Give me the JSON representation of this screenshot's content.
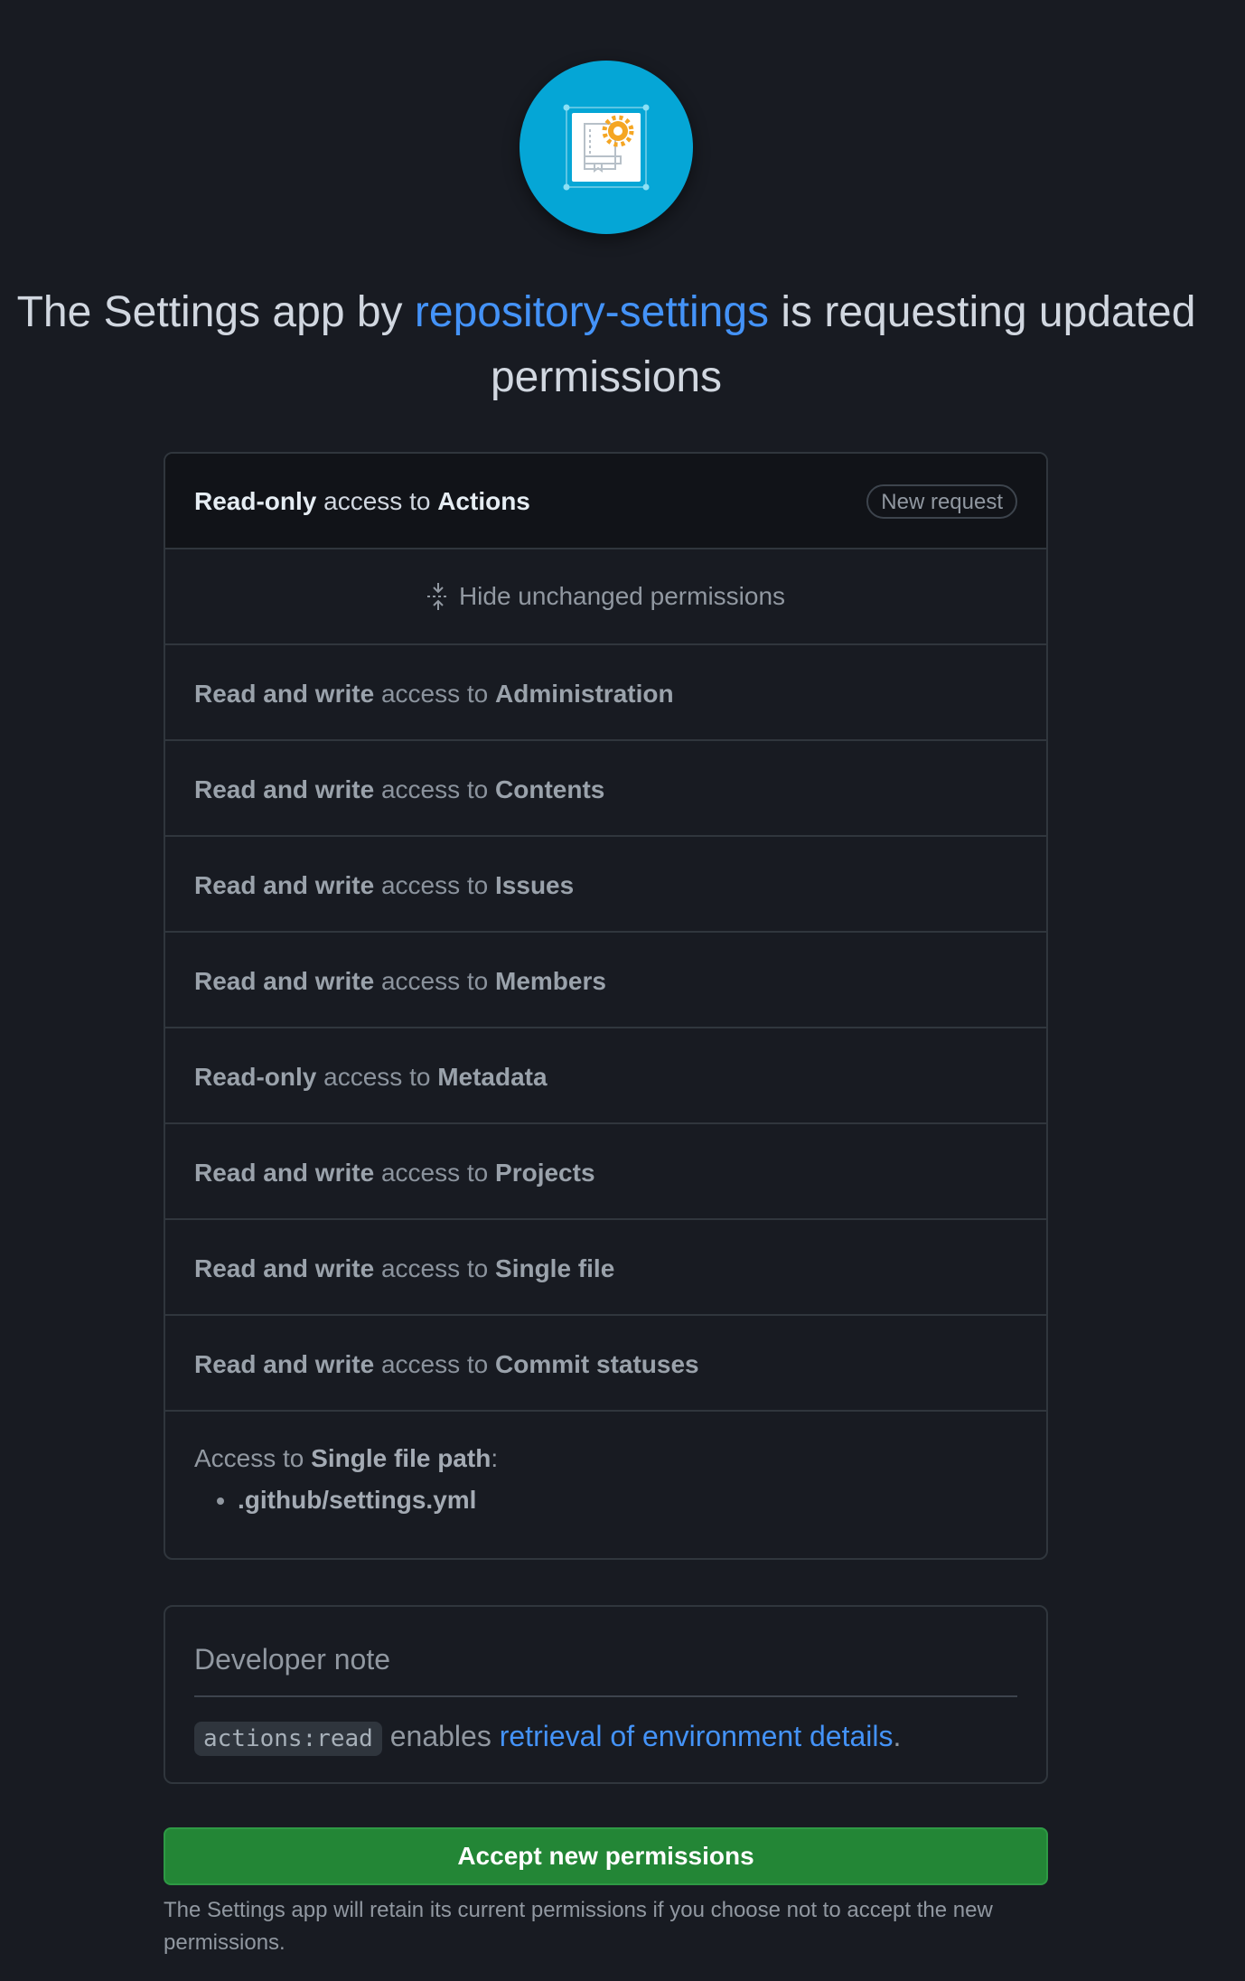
{
  "app": {
    "icon": "settings-app-icon",
    "accent_color": "#05a6d6"
  },
  "headline": {
    "prefix": "The Settings app by ",
    "org_link": "repository-settings",
    "suffix": " is requesting updated permissions"
  },
  "permissions": {
    "new_request": {
      "level": "Read-only",
      "middle": " access to ",
      "resource": "Actions",
      "badge": "New request"
    },
    "hide_label": "Hide unchanged permissions",
    "unchanged": [
      {
        "level": "Read and write",
        "middle": " access to ",
        "resource": "Administration"
      },
      {
        "level": "Read and write",
        "middle": " access to ",
        "resource": "Contents"
      },
      {
        "level": "Read and write",
        "middle": " access to ",
        "resource": "Issues"
      },
      {
        "level": "Read and write",
        "middle": " access to ",
        "resource": "Members"
      },
      {
        "level": "Read-only",
        "middle": " access to ",
        "resource": "Metadata"
      },
      {
        "level": "Read and write",
        "middle": " access to ",
        "resource": "Projects"
      },
      {
        "level": "Read and write",
        "middle": " access to ",
        "resource": "Single file"
      },
      {
        "level": "Read and write",
        "middle": " access to ",
        "resource": "Commit statuses"
      }
    ],
    "file_path": {
      "prefix": "Access to ",
      "label": "Single file path",
      "suffix": ":",
      "paths": [
        ".github/settings.yml"
      ]
    }
  },
  "developer_note": {
    "title": "Developer note",
    "code": "actions:read",
    "middle": " enables ",
    "link": "retrieval of environment details",
    "end": "."
  },
  "actions": {
    "accept_label": "Accept new permissions",
    "accept_color": "#238636",
    "retain_note": "The Settings app will retain its current permissions if you choose not to accept the new permissions."
  }
}
